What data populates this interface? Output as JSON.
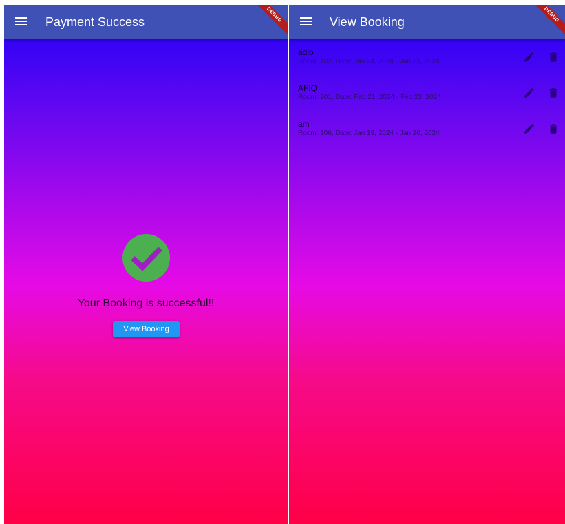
{
  "left_screen": {
    "appbar": {
      "title": "Payment Success",
      "menu_icon": "menu-icon"
    },
    "debug_banner": "DEBUG",
    "success_icon": "check-circle-icon",
    "message": "Your Booking is successful!!",
    "view_booking_button": "View Booking"
  },
  "right_screen": {
    "appbar": {
      "title": "View Booking",
      "menu_icon": "menu-icon"
    },
    "debug_banner": "DEBUG",
    "bookings": [
      {
        "name": "adib",
        "details": "Room: 102, Date: Jan 24, 2024 - Jan 25, 2024"
      },
      {
        "name": "AFIQ",
        "details": "Room: 201, Date: Feb 21, 2024 - Feb 23, 2024"
      },
      {
        "name": "am",
        "details": "Room: 106, Date: Jan 19, 2024 - Jan 20, 2024"
      }
    ],
    "row_actions": {
      "edit_icon": "edit-icon",
      "delete_icon": "delete-icon"
    }
  },
  "colors": {
    "appbar": "#3f51b5",
    "button": "#2196f3",
    "success": "#4caf50",
    "debug": "#b71c1c",
    "gradient_top": "#1c00f8",
    "gradient_mid": "#e60ae6",
    "gradient_bottom": "#ff0047"
  }
}
